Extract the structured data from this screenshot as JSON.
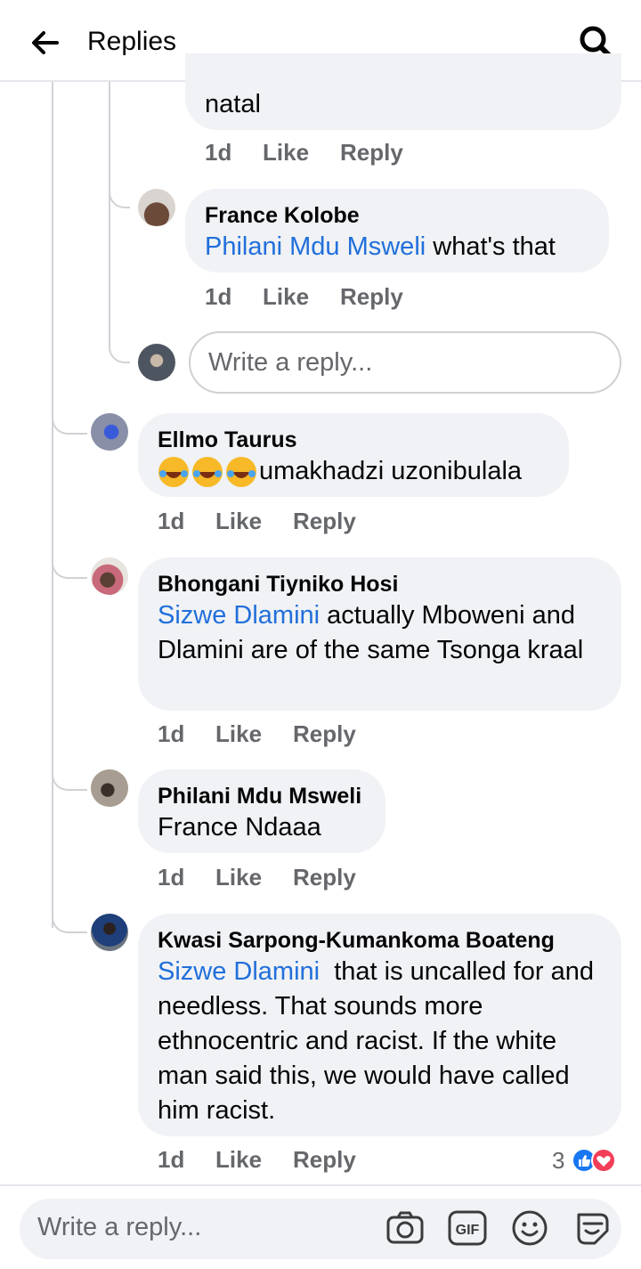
{
  "header": {
    "title": "Replies"
  },
  "comments": [
    {
      "text_tail": "natal",
      "time": "1d",
      "like": "Like",
      "reply": "Reply"
    },
    {
      "author": "France Kolobe",
      "mention": "Philani Mdu Msweli",
      "text": " what's that",
      "time": "1d",
      "like": "Like",
      "reply": "Reply"
    },
    {
      "author": "Ellmo Taurus",
      "text": "umakhadzi uzonibulala",
      "time": "1d",
      "like": "Like",
      "reply": "Reply"
    },
    {
      "author": "Bhongani Tiyniko Hosi",
      "mention": "Sizwe Dlamini",
      "text": " actually Mboweni and Dlamini are of the same Tsonga kraal",
      "time": "1d",
      "like": "Like",
      "reply": "Reply"
    },
    {
      "author": "Philani Mdu Msweli",
      "text": "France Ndaaa",
      "time": "1d",
      "like": "Like",
      "reply": "Reply"
    },
    {
      "author": "Kwasi Sarpong-Kumankoma Boateng",
      "mention": "Sizwe Dlamini",
      "text": "  that is uncalled for and needless. That sounds more ethnocentric and racist. If the white man said this, we would have called him racist.",
      "time": "1d",
      "like": "Like",
      "reply": "Reply",
      "reaction_count": "3"
    }
  ],
  "nested_reply_placeholder": "Write a reply...",
  "bottom_bar": {
    "placeholder": "Write a reply..."
  },
  "icons": {
    "back": "back-arrow-icon",
    "search": "search-icon",
    "camera": "camera-icon",
    "gif": "gif-icon",
    "emoji": "emoji-icon",
    "sticker": "sticker-icon",
    "laugh": "laughing-emoji-icon"
  },
  "colors": {
    "mention": "#216fdb",
    "bubble": "#f0f2f5",
    "like_reaction": "#1877f2",
    "love_reaction": "#f33e58"
  }
}
